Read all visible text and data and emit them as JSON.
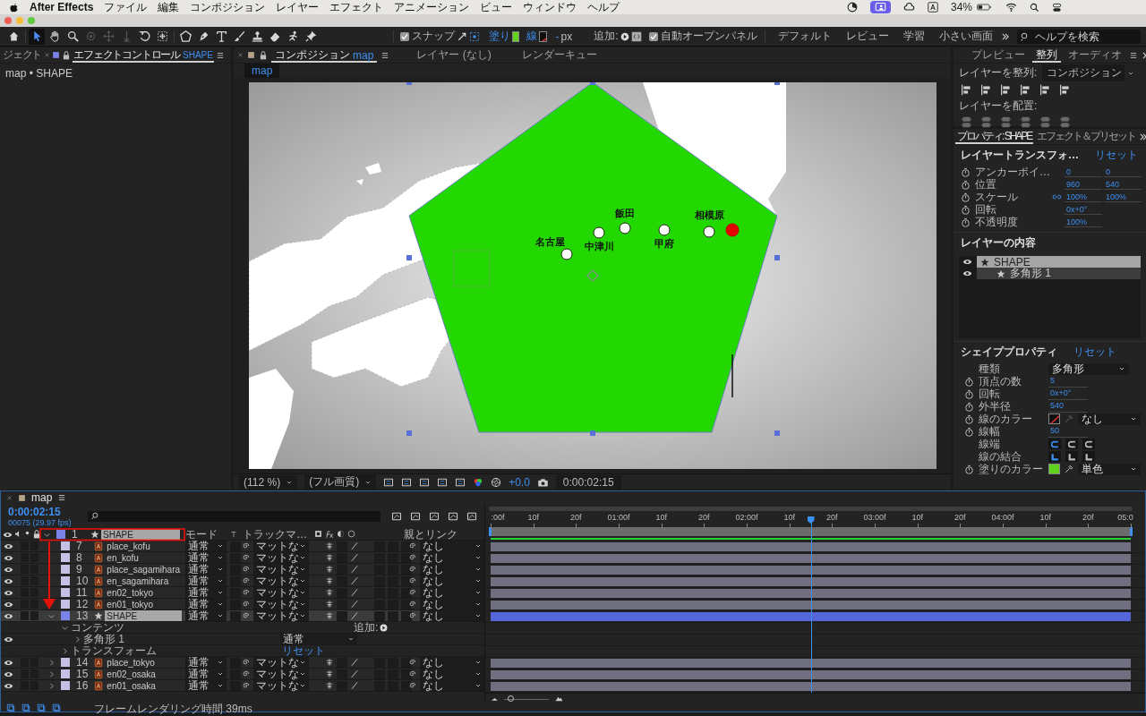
{
  "menubar": {
    "app_name": "After Effects",
    "items": [
      "ファイル",
      "編集",
      "コンポジション",
      "レイヤー",
      "エフェクト",
      "アニメーション",
      "ビュー",
      "ウィンドウ",
      "ヘルプ"
    ],
    "battery": "34%"
  },
  "toolbar": {
    "tools": [
      {
        "kind": "home",
        "selected": false,
        "disabled": false
      },
      {
        "kind": "select",
        "selected": true,
        "disabled": false
      },
      {
        "kind": "hand",
        "selected": false,
        "disabled": false
      },
      {
        "kind": "zoom",
        "selected": false,
        "disabled": false
      },
      {
        "kind": "orbit",
        "selected": false,
        "disabled": true
      },
      {
        "kind": "pan",
        "selected": false,
        "disabled": true
      },
      {
        "kind": "dolly",
        "selected": false,
        "disabled": true
      },
      {
        "kind": "rotate",
        "selected": false,
        "disabled": false
      },
      {
        "kind": "anchor",
        "selected": false,
        "disabled": false
      },
      {
        "kind": "shape",
        "selected": false,
        "disabled": false
      },
      {
        "kind": "pen",
        "selected": false,
        "disabled": false
      },
      {
        "kind": "text",
        "selected": false,
        "disabled": false
      },
      {
        "kind": "brush",
        "selected": false,
        "disabled": false
      },
      {
        "kind": "stamp",
        "selected": false,
        "disabled": false
      },
      {
        "kind": "eraser",
        "selected": false,
        "disabled": false
      },
      {
        "kind": "puppet",
        "selected": false,
        "disabled": false
      },
      {
        "kind": "pin",
        "selected": false,
        "disabled": false
      }
    ],
    "snap": {
      "label": "スナップ",
      "checked": true
    },
    "fill_label": "塗り",
    "stroke_label": "線",
    "stroke_width": "-",
    "unit": "px",
    "add_label": "追加:",
    "auto_open": {
      "label": "自動オープンパネル",
      "checked": true
    },
    "workspaces": [
      "デフォルト",
      "レビュー",
      "学習",
      "小さい画面"
    ],
    "help_search": {
      "placeholder": "ヘルプを検索"
    }
  },
  "left_panel": {
    "tabs": [
      {
        "label": "ジェクト",
        "selected": false
      },
      {
        "label": "エフェクトコントロール",
        "suffix": "SHAPE",
        "selected": true
      }
    ],
    "breadcrumb": "map • SHAPE"
  },
  "comp_panel": {
    "tabs": [
      {
        "label": "コンポジション",
        "suffix": "map",
        "selected": true
      },
      {
        "label": "レイヤー (なし)",
        "selected": false
      },
      {
        "label": "レンダーキュー",
        "selected": false
      }
    ],
    "subtab": "map",
    "places": [
      "名古屋",
      "中津川",
      "飯田",
      "甲府",
      "相模原"
    ],
    "zoom": "(112 %)",
    "quality": "(フル画質)",
    "exposure": "+0.0",
    "timecode": "0:00:02:15"
  },
  "right_panel": {
    "tabs": [
      {
        "label": "プレビュー",
        "selected": false
      },
      {
        "label": "整列",
        "selected": true
      },
      {
        "label": "オーディオ",
        "selected": false
      }
    ],
    "align": {
      "label": "レイヤーを整列:",
      "target": "コンポジション",
      "distribute_label": "レイヤーを配置:"
    },
    "prop_tabs": [
      {
        "label": "プロパティ: SHAPE",
        "selected": true
      },
      {
        "label": "エフェクト＆プリセット",
        "selected": false
      }
    ],
    "transform": {
      "title": "レイヤートランスフォ…",
      "reset": "リセット",
      "rows": [
        {
          "label": "アンカーポイ…",
          "values": [
            "0",
            "0"
          ],
          "linked": false
        },
        {
          "label": "位置",
          "values": [
            "960",
            "540"
          ],
          "linked": false
        },
        {
          "label": "スケール",
          "values": [
            "100%",
            "100%"
          ],
          "linked": true
        },
        {
          "label": "回転",
          "values": [
            "0x+0°"
          ],
          "linked": false
        },
        {
          "label": "不透明度",
          "values": [
            "100%"
          ],
          "linked": false
        }
      ]
    },
    "contents": {
      "title": "レイヤーの内容",
      "items": [
        {
          "name": "SHAPE",
          "selected": true,
          "children": [
            {
              "name": "多角形 1",
              "selected": false
            }
          ]
        }
      ]
    },
    "shape": {
      "title": "シェイププロパティ",
      "reset": "リセット",
      "rows": [
        {
          "kind": "dropdown",
          "label": "種類",
          "value": "多角形"
        },
        {
          "kind": "number",
          "label": "頂点の数",
          "value": "5"
        },
        {
          "kind": "number",
          "label": "回転",
          "value": "0x+0°"
        },
        {
          "kind": "number",
          "label": "外半径",
          "value": "540"
        },
        {
          "kind": "stroke",
          "label": "線のカラー",
          "value": "なし"
        },
        {
          "kind": "number",
          "label": "線幅",
          "value": "50"
        },
        {
          "kind": "cap",
          "label": "線端",
          "options": [
            {
              "selected": true
            },
            {
              "selected": false
            },
            {
              "selected": false
            }
          ]
        },
        {
          "kind": "join",
          "label": "線の結合",
          "options": [
            {
              "selected": true
            },
            {
              "selected": false
            },
            {
              "selected": false
            }
          ]
        },
        {
          "kind": "fill",
          "label": "塗りのカラー",
          "value": "単色"
        }
      ]
    }
  },
  "timeline": {
    "tab": "map",
    "timecode": "0:00:02:15",
    "frame_info": "00075 (29.97 fps)",
    "columns": {
      "mode": "モード",
      "track_matte": "トラックマ…",
      "parent": "親とリンク"
    },
    "layers": [
      {
        "number": "1",
        "name": "SHAPE",
        "kind": "shape",
        "color": "#7b83e8",
        "expanded": true,
        "selected": true
      },
      {
        "number": "7",
        "name": "place_kofu",
        "kind": "text",
        "color": "#c4c1e4",
        "selected": false,
        "mode": "通常",
        "matte": "マットな",
        "parent": "なし"
      },
      {
        "number": "8",
        "name": "en_kofu",
        "kind": "text",
        "color": "#c4c1e4",
        "selected": false,
        "mode": "通常",
        "matte": "マットな",
        "parent": "なし"
      },
      {
        "number": "9",
        "name": "place_sagamihara",
        "kind": "text",
        "color": "#c4c1e4",
        "selected": false,
        "mode": "通常",
        "matte": "マットな",
        "parent": "なし"
      },
      {
        "number": "10",
        "name": "en_sagamihara",
        "kind": "text",
        "color": "#c4c1e4",
        "selected": false,
        "mode": "通常",
        "matte": "マットな",
        "parent": "なし"
      },
      {
        "number": "11",
        "name": "en02_tokyo",
        "kind": "text",
        "color": "#c4c1e4",
        "selected": false,
        "mode": "通常",
        "matte": "マットな",
        "parent": "なし"
      },
      {
        "number": "12",
        "name": "en01_tokyo",
        "kind": "text",
        "color": "#c4c1e4",
        "selected": false,
        "mode": "通常",
        "matte": "マットな",
        "parent": "なし"
      },
      {
        "number": "13",
        "name": "SHAPE",
        "kind": "shape",
        "color": "#7b83e8",
        "expanded": true,
        "selected": true,
        "mode": "通常",
        "matte": "マットな",
        "parent": "なし",
        "children": [
          {
            "label": "コンテンツ",
            "expanded": true,
            "add_label": "追加:",
            "children": [
              {
                "label": "多角形 1",
                "expanded": false,
                "mode": "通常"
              }
            ]
          },
          {
            "label": "トランスフォーム",
            "expanded": false,
            "reset": "リセット"
          }
        ]
      },
      {
        "number": "14",
        "name": "place_tokyo",
        "kind": "text",
        "color": "#c4c1e4",
        "expanded": false,
        "selected": false,
        "mode": "通常",
        "matte": "マットな",
        "parent": "なし"
      },
      {
        "number": "15",
        "name": "en02_osaka",
        "kind": "text",
        "color": "#c4c1e4",
        "expanded": false,
        "selected": false,
        "mode": "通常",
        "matte": "マットな",
        "parent": "なし"
      },
      {
        "number": "16",
        "name": "en01_osaka",
        "kind": "text",
        "color": "#c4c1e4",
        "expanded": false,
        "selected": false,
        "mode": "通常",
        "matte": "マットな",
        "parent": "なし"
      }
    ],
    "ticks": [
      ":00f",
      "10f",
      "20f",
      "01:00f",
      "10f",
      "20f",
      "02:00f",
      "10f",
      "20f",
      "03:00f",
      "10f",
      "20f",
      "04:00f",
      "10f",
      "20f",
      "05:0"
    ],
    "playhead": {
      "level": 0.5
    },
    "zoom_slider": {
      "level": 0.1
    },
    "render_time": "フレームレンダリング時間 39ms"
  }
}
